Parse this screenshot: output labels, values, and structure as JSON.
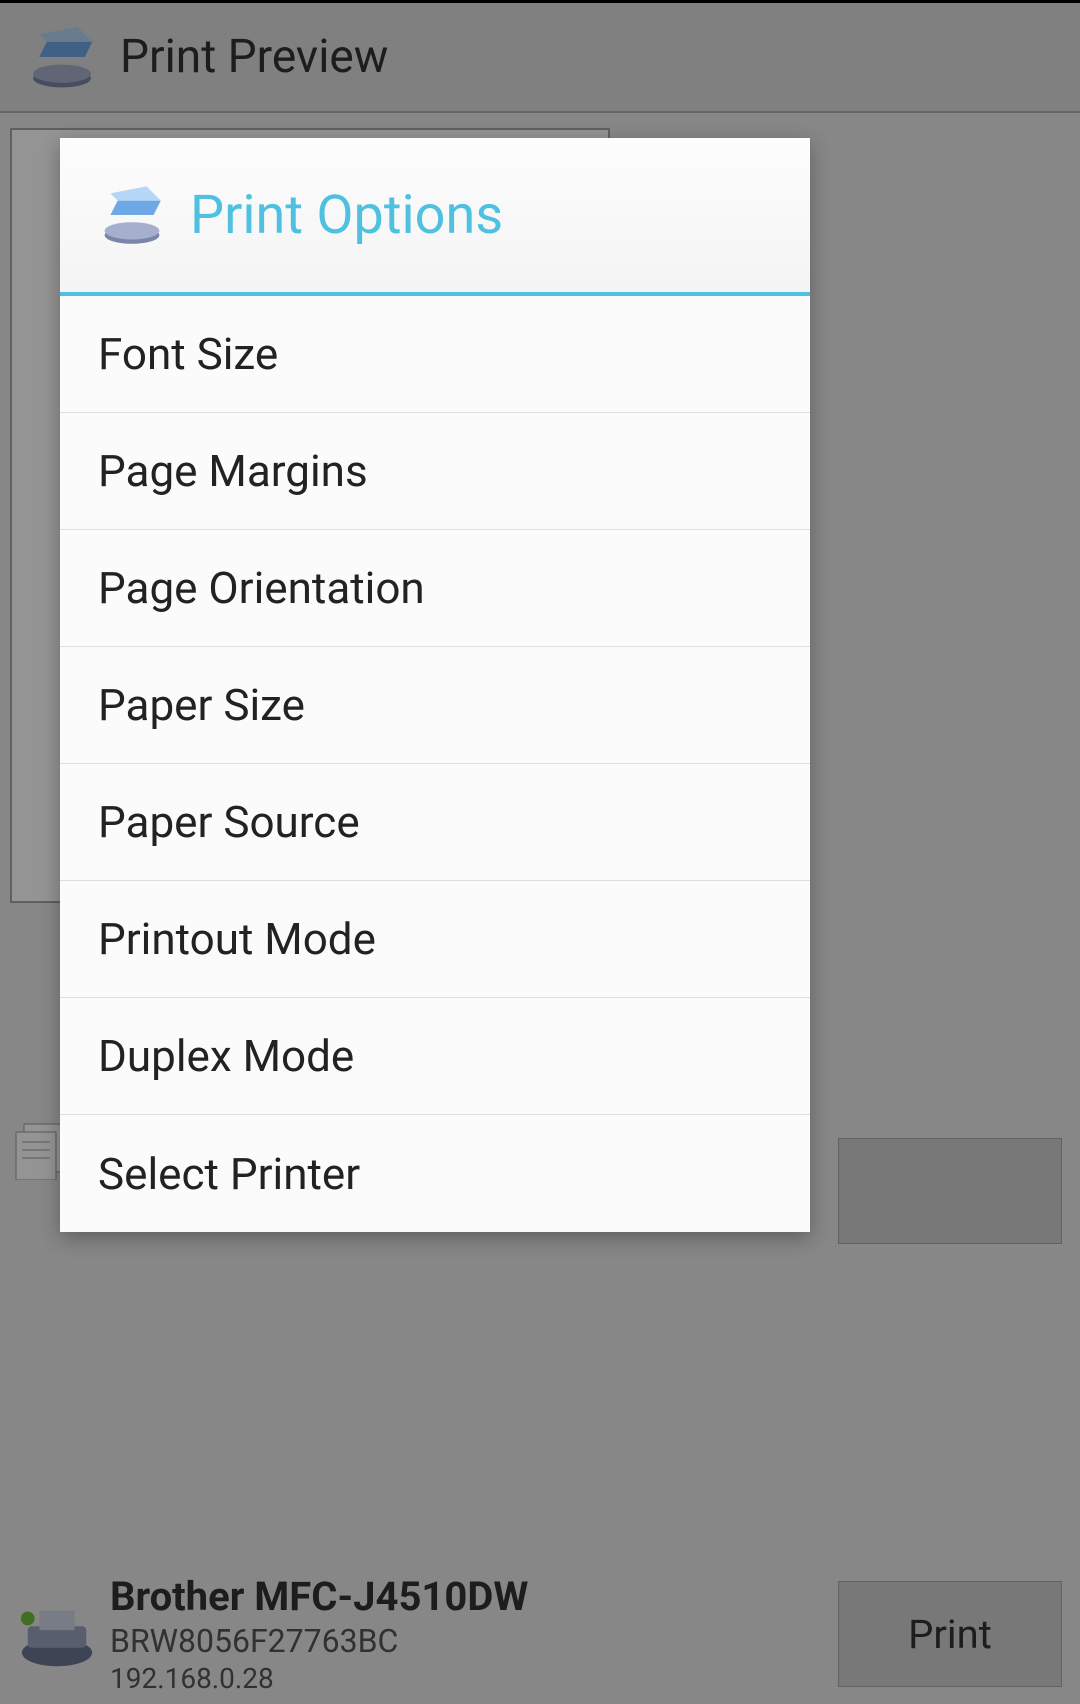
{
  "header": {
    "title": "Print Preview"
  },
  "dialog": {
    "title": "Print Options",
    "options": [
      "Font Size",
      "Page Margins",
      "Page Orientation",
      "Paper Size",
      "Paper Source",
      "Printout Mode",
      "Duplex Mode",
      "Select Printer"
    ]
  },
  "printer": {
    "name": "Brother MFC-J4510DW",
    "host": "BRW8056F27763BC",
    "ip": "192.168.0.28"
  },
  "buttons": {
    "print": "Print"
  }
}
